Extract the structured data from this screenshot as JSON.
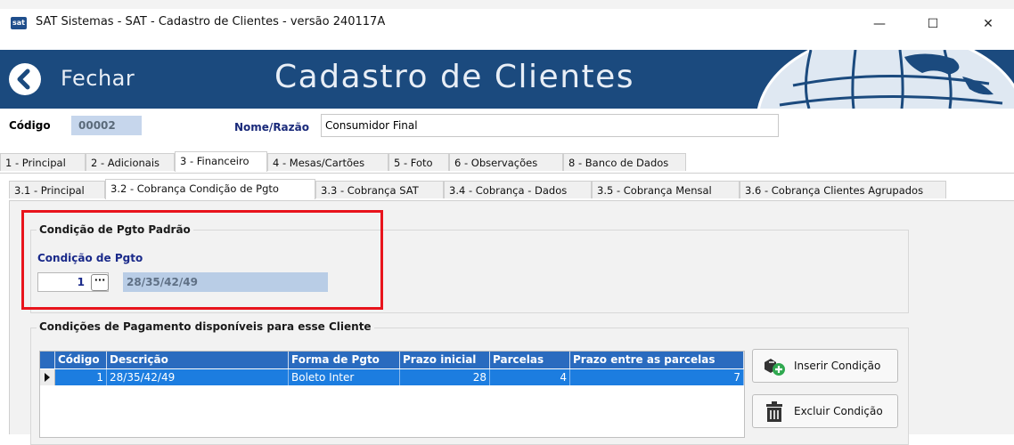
{
  "window": {
    "title": "SAT Sistemas - SAT - Cadastro de Clientes - versão 240117A",
    "app_icon_text": "sat",
    "minimize": "—",
    "maximize": "☐",
    "close": "✕"
  },
  "banner": {
    "back_label": "Fechar",
    "title": "Cadastro de Clientes",
    "color": "#1b4a7e"
  },
  "header": {
    "codigo_label": "Código",
    "codigo_value": "00002",
    "nome_label": "Nome/Razão",
    "nome_value": "Consumidor Final"
  },
  "tabs": [
    {
      "label": "1 - Principal",
      "active": false
    },
    {
      "label": "2 - Adicionais",
      "active": false
    },
    {
      "label": "3 - Financeiro",
      "active": true
    },
    {
      "label": "4 - Mesas/Cartões",
      "active": false
    },
    {
      "label": "5 - Foto",
      "active": false
    },
    {
      "label": "6 - Observações",
      "active": false
    },
    {
      "label": "8 - Banco de Dados",
      "active": false
    }
  ],
  "subtabs": [
    {
      "label": "3.1 - Principal",
      "active": false
    },
    {
      "label": "3.2 - Cobrança Condição de Pgto",
      "active": true
    },
    {
      "label": "3.3 - Cobrança SAT",
      "active": false
    },
    {
      "label": "3.4 - Cobrança - Dados",
      "active": false
    },
    {
      "label": "3.5 - Cobrança Mensal",
      "active": false
    },
    {
      "label": "3.6 - Cobrança Clientes Agrupados",
      "active": false
    }
  ],
  "default_condition": {
    "group_title": "Condição de Pgto Padrão",
    "field_label": "Condição de Pgto",
    "code": "1",
    "lookup_button": "···",
    "description": "28/35/42/49"
  },
  "conditions": {
    "group_title": "Condições de Pagamento disponíveis para esse Cliente",
    "columns": [
      "Código",
      "Descrição",
      "Forma de Pgto",
      "Prazo inicial",
      "Parcelas",
      "Prazo entre as parcelas"
    ],
    "rows": [
      {
        "codigo": "1",
        "descricao": "28/35/42/49",
        "forma": "Boleto Inter",
        "prazo_inicial": "28",
        "parcelas": "4",
        "prazo_entre": "7"
      }
    ],
    "insert_button": "Inserir Condição",
    "delete_button": "Excluir Condição"
  }
}
